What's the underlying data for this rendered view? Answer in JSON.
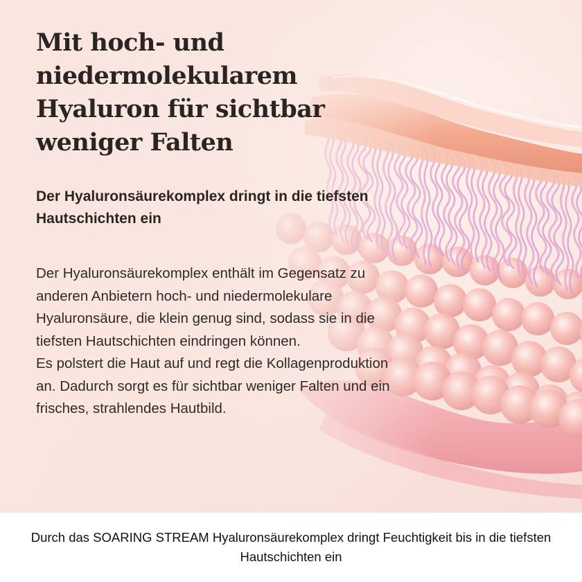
{
  "headline": "Mit hoch- und niedermolekularem Hyaluron für sichtbar weniger Falten",
  "subheadline": "Der Hyaluronsäurekomplex dringt in die tiefsten Hautschichten ein",
  "body": "Der Hyaluronsäurekomplex enthält im Gegensatz zu anderen Anbietern hoch- und niedermolekulare Hyaluronsäure, die klein genug sind, sodass sie in die tiefsten Hautschichten eindringen können.\nEs polstert die Haut auf und regt die Kollagenproduktion an. Dadurch sorgt es für sichtbar weniger Falten und ein frisches, strahlendes Hautbild.",
  "caption": "Durch das SOARING STREAM Hyaluronsäurekomplex dringt Feuchtigkeit bis in die tiefsten Hautschichten ein",
  "colors": {
    "background": "#fae6e0",
    "skin_top": "#f2a48e",
    "fibers": "#e9a8cf",
    "spheres": "#f5b7b2",
    "base_layer": "#ee9ea5",
    "text": "#2a2523"
  }
}
